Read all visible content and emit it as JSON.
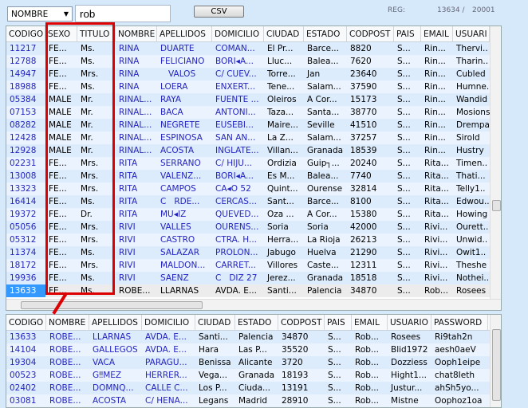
{
  "toolbar": {
    "field_select": "NOMBRE",
    "search_value": "rob",
    "csv_label": "CSV",
    "reg_label": "REG:",
    "reg_current": "13634 /",
    "reg_total": "20001"
  },
  "colors": {
    "background": "#d6e9fb",
    "row_even": "#dcecfd",
    "row_odd": "#ebf4fe",
    "selected_row": "#ececec",
    "selected_cell": "#3399ff",
    "link_text": "#2424c0",
    "highlight": "#dd0000"
  },
  "main_table": {
    "columns": [
      "CODIGO",
      "SEXO",
      "TITULO",
      "NOMBRE",
      "APELLIDOS",
      "DOMICILIO",
      "CIUDAD",
      "ESTADO",
      "CODPOST",
      "PAIS",
      "EMAIL",
      "USUARI"
    ],
    "selected_index": 19,
    "rows": [
      [
        "11217",
        "FE...",
        "Ms.",
        "RINA",
        "DUARTE",
        "COMAN...",
        "El Pr...",
        "Barce...",
        "8820",
        "S...",
        "Rin...",
        "Thervi.."
      ],
      [
        "12788",
        "FE...",
        "Ms.",
        "RINA",
        "FELICIANO",
        "BORI◂A...",
        "Lluc...",
        "Balea...",
        "7620",
        "S...",
        "Rin...",
        "Tharin.."
      ],
      [
        "14947",
        "FE...",
        "Mrs.",
        "RINA",
        "   VALOS",
        "C/ CUEV...",
        "Torre...",
        "Jan",
        "23640",
        "S...",
        "Rin...",
        "Cubled"
      ],
      [
        "18988",
        "FE...",
        "Ms.",
        "RINA",
        "LOERA",
        "ENXERT...",
        "Tene...",
        "Salam...",
        "37590",
        "S...",
        "Rin...",
        "Humne."
      ],
      [
        "05384",
        "MALE",
        "Mr.",
        "RINAL...",
        "RAYA",
        "FUENTE ...",
        "Oleiros",
        "A Cor...",
        "15173",
        "S...",
        "Rin...",
        "Wandid"
      ],
      [
        "07153",
        "MALE",
        "Mr.",
        "RINAL...",
        "BACA",
        "ANTONI...",
        "Taza...",
        "Santa...",
        "38770",
        "S...",
        "Rin...",
        "Mosions"
      ],
      [
        "08282",
        "MALE",
        "Mr.",
        "RINAL...",
        "NEGRETE",
        "EUSEBI...",
        "Maire...",
        "Seville",
        "41510",
        "S...",
        "Rin...",
        "Drempa"
      ],
      [
        "12428",
        "MALE",
        "Mr.",
        "RINAL...",
        "ESPINOSA",
        "SAN AN...",
        "La Z...",
        "Salam...",
        "37257",
        "S...",
        "Rin...",
        "Sirold"
      ],
      [
        "12928",
        "MALE",
        "Mr.",
        "RINAL...",
        "ACOSTA",
        "INGLATE...",
        "Villan...",
        "Granada",
        "18539",
        "S...",
        "Rin...",
        "Hustry"
      ],
      [
        "02231",
        "FE...",
        "Mrs.",
        "RITA",
        "SERRANO",
        "C/ HIJU...",
        "Ordizia",
        "Guip┐...",
        "20240",
        "S...",
        "Rita...",
        "Timen.."
      ],
      [
        "13008",
        "FE...",
        "Mrs.",
        "RITA",
        "VALENZ...",
        "BORI◂A...",
        "Es M...",
        "Balea...",
        "7740",
        "S...",
        "Rita...",
        "Thati..."
      ],
      [
        "13323",
        "FE...",
        "Mrs.",
        "RITA",
        "CAMPOS",
        "CA◂O 52",
        "Quint...",
        "Ourense",
        "32814",
        "S...",
        "Rita...",
        "Telly1.."
      ],
      [
        "16414",
        "FE...",
        "Ms.",
        "RITA",
        "C   RDE...",
        "CERCAS...",
        "Sant...",
        "Barce...",
        "8100",
        "S...",
        "Rita...",
        "Edwou.."
      ],
      [
        "19372",
        "FE...",
        "Dr.",
        "RITA",
        "MU◂IZ",
        "QUEVED...",
        "Oza ...",
        "A Cor...",
        "15380",
        "S...",
        "Rita...",
        "Howing"
      ],
      [
        "05056",
        "FE...",
        "Mrs.",
        "RIVI",
        "VALLES",
        "OURENS...",
        "Soria",
        "Soria",
        "42000",
        "S...",
        "Rivi...",
        "Ourett.."
      ],
      [
        "05312",
        "FE...",
        "Mrs.",
        "RIVI",
        "CASTRO",
        "CTRA. H...",
        "Herra...",
        "La Rioja",
        "26213",
        "S...",
        "Rivi...",
        "Unwid.."
      ],
      [
        "11374",
        "FE...",
        "Ms.",
        "RIVI",
        "SALAZAR",
        "PROLON...",
        "Jabugo",
        "Huelva",
        "21290",
        "S...",
        "Rivi...",
        "Owit1.."
      ],
      [
        "18172",
        "FE...",
        "Mrs.",
        "RIVI",
        "MALDON...",
        "CARRET...",
        "Villores",
        "Caste...",
        "12311",
        "S...",
        "Rivi...",
        "Theshe"
      ],
      [
        "19936",
        "FE...",
        "Ms.",
        "RIVI",
        "SAENZ",
        "C   DIZ 27",
        "Jerez...",
        "Granada",
        "18518",
        "S...",
        "Rivi...",
        "Nothei.."
      ],
      [
        "13633",
        "FE...",
        "Ms.",
        "ROBE...",
        "LLARNAS",
        "AVDA. E...",
        "Santi...",
        "Palencia",
        "34870",
        "S...",
        "Rob...",
        "Rosees"
      ]
    ],
    "vertical_scroll_position": 0.68,
    "horizontal_scroll_position": 0.0
  },
  "result_table": {
    "columns": [
      "CODIGO",
      "NOMBRE",
      "APELLIDOS",
      "DOMICILIO",
      "CIUDAD",
      "ESTADO",
      "CODPOST",
      "PAIS",
      "EMAIL",
      "USUARIO",
      "PASSWORD"
    ],
    "rows": [
      [
        "13633",
        "ROBE...",
        "LLARNAS",
        "AVDA. E...",
        "Santi...",
        "Palencia",
        "34870",
        "S...",
        "Rob...",
        "Rosees",
        "Ri9tah2n"
      ],
      [
        "14104",
        "ROBE...",
        "GALLEGOS",
        "AVDA. E...",
        "Hara",
        "Las P...",
        "35520",
        "S...",
        "Rob...",
        "Blid1972",
        "aesh0aeV"
      ],
      [
        "19304",
        "ROBE...",
        "VACA",
        "PARAGU...",
        "Benissa",
        "Alicante",
        "3720",
        "S...",
        "Rob...",
        "Dozziess",
        "Ooph1eipe"
      ],
      [
        "00523",
        "ROBE...",
        "G‼MEZ",
        "HERRER...",
        "Vega...",
        "Granada",
        "18193",
        "S...",
        "Rob...",
        "Hight1...",
        "chat8Ieth"
      ],
      [
        "02402",
        "ROBE...",
        "DOMNQ...",
        "CALLE C...",
        "Los P...",
        "Ciuda...",
        "13191",
        "S...",
        "Rob...",
        "Justur...",
        "ahSh5yo..."
      ],
      [
        "03081",
        "ROBE...",
        "ACOSTA",
        "C/ HENA...",
        "Legans",
        "Madrid",
        "28910",
        "S...",
        "Rob...",
        "Mistne",
        "Oophoz1oa"
      ]
    ],
    "vertical_scroll_position": 0.0
  }
}
